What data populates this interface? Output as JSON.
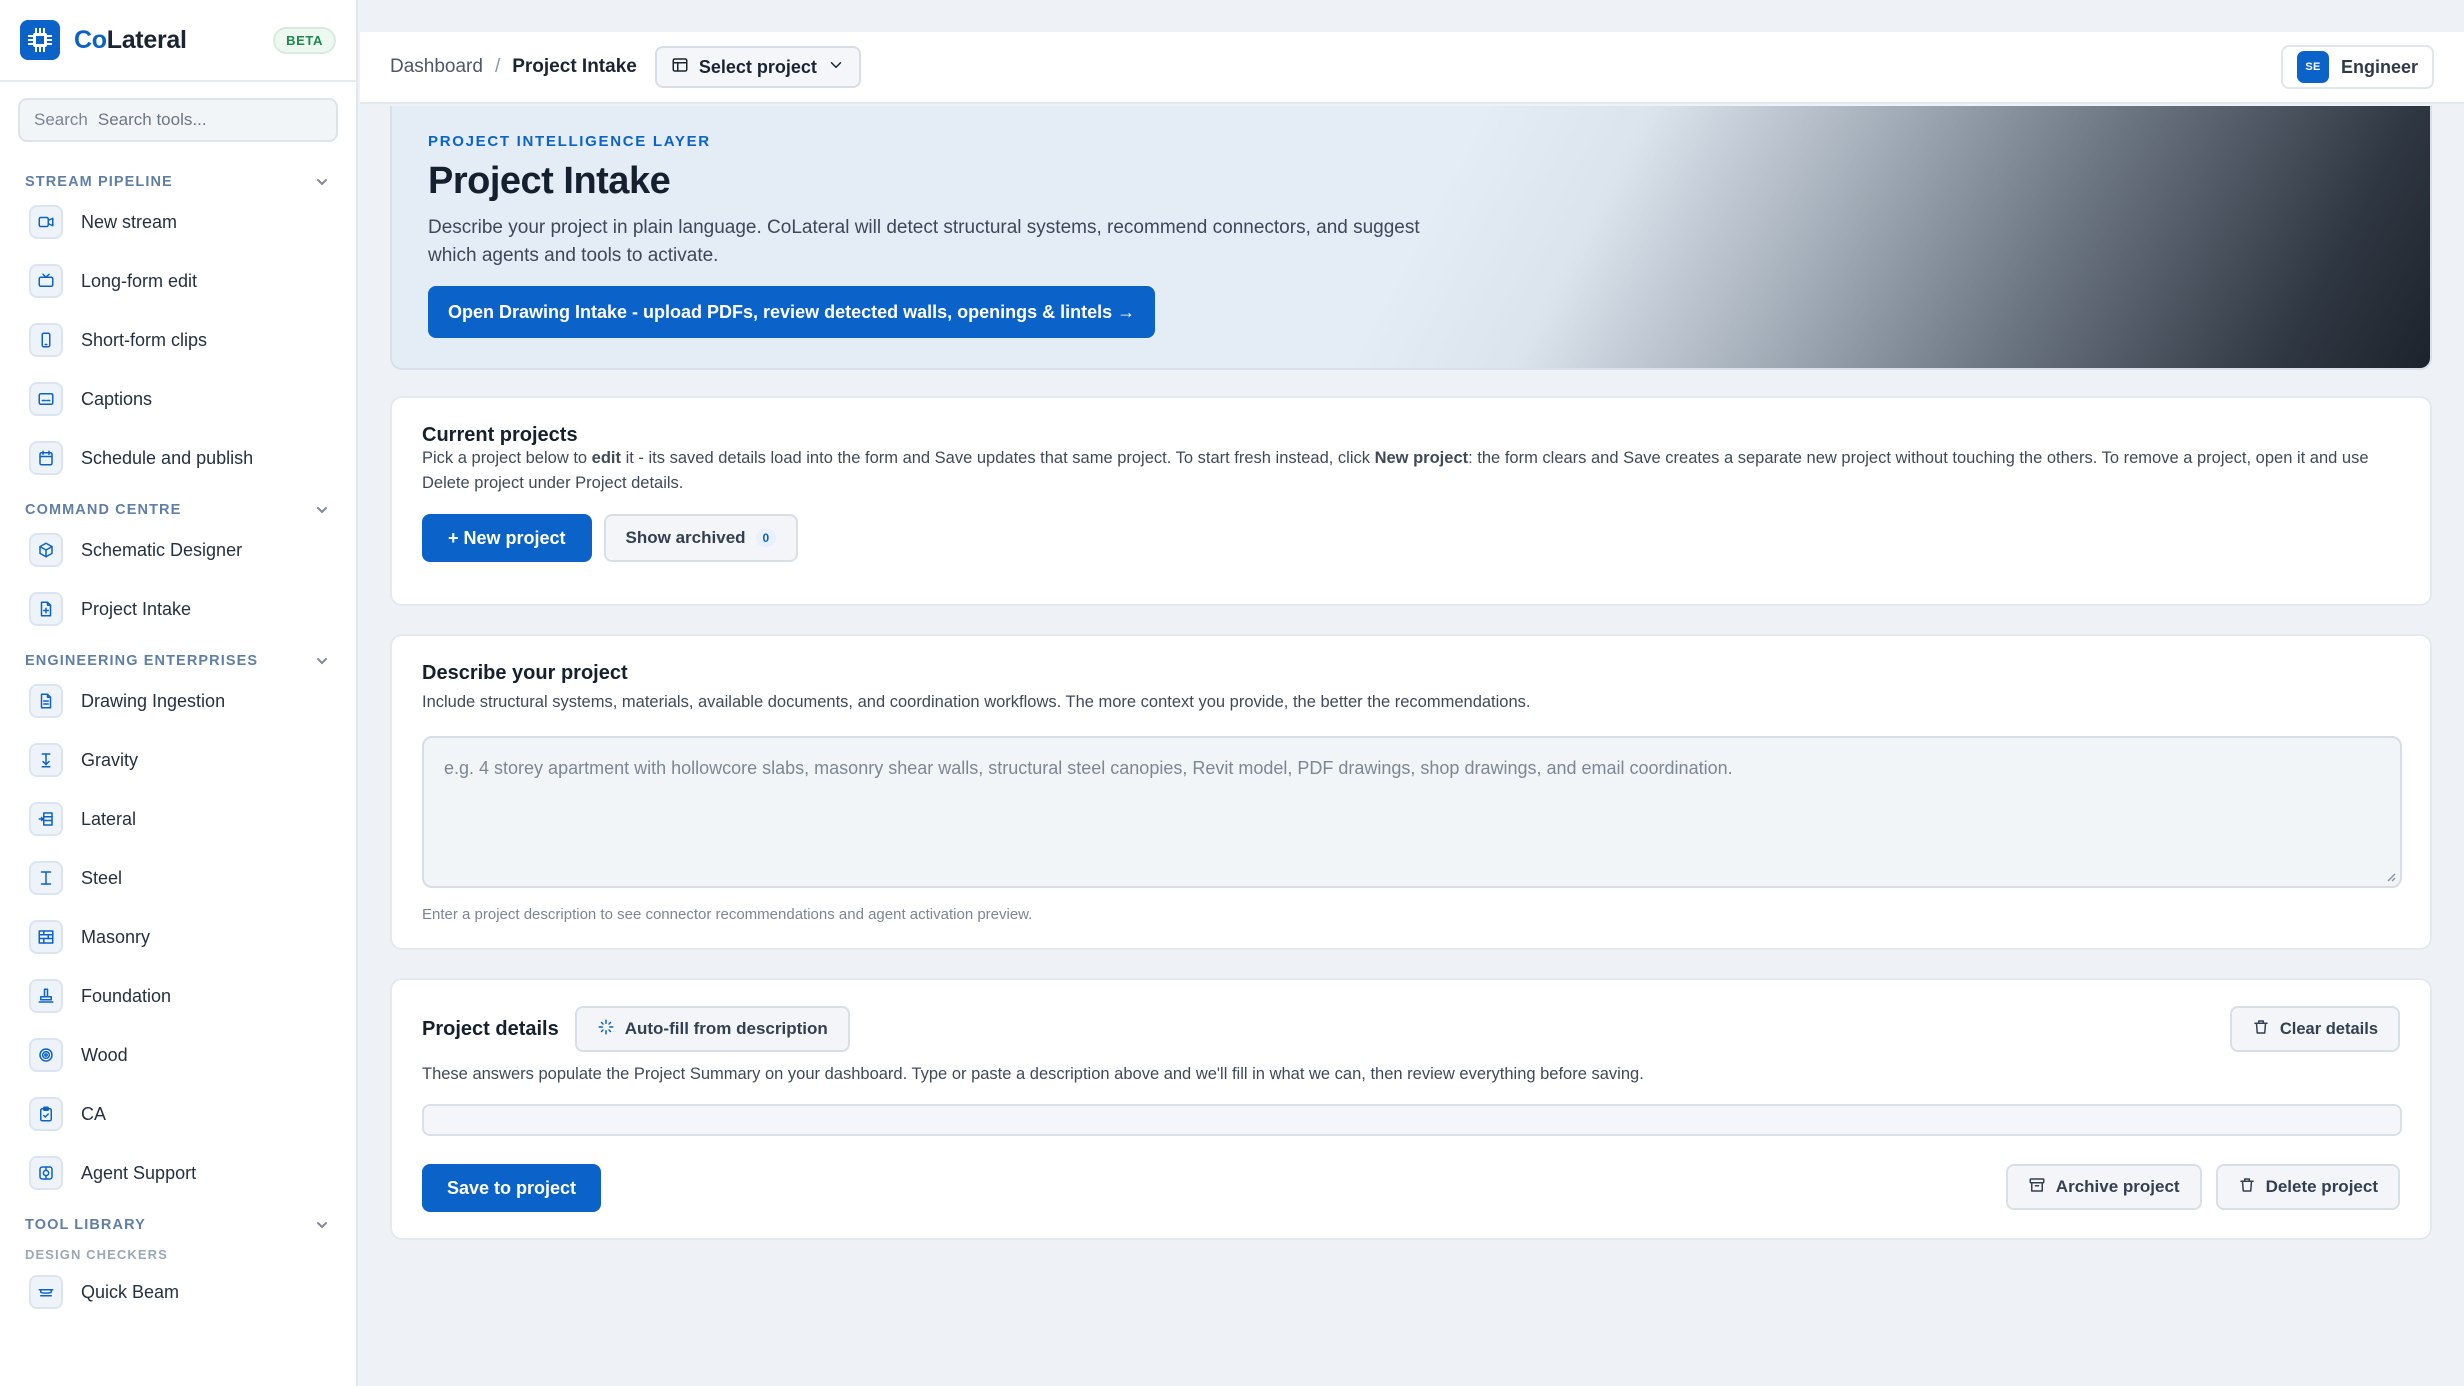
{
  "colors": {
    "accent": "#0b63c9",
    "beta": "#1a8a4a",
    "section": "#5f7fa6"
  },
  "brand": {
    "name_prefix": "Co",
    "name_suffix": "Lateral",
    "badge": "BETA"
  },
  "search": {
    "label": "Search",
    "placeholder": "Search tools..."
  },
  "sidebar": {
    "stream": {
      "title": "STREAM PIPELINE",
      "items": [
        {
          "label": "New stream",
          "icon": "stream-icon"
        },
        {
          "label": "Long-form edit",
          "icon": "tv-icon"
        },
        {
          "label": "Short-form clips",
          "icon": "phone-icon"
        },
        {
          "label": "Captions",
          "icon": "captions-icon"
        },
        {
          "label": "Schedule and publish",
          "icon": "calendar-icon"
        }
      ]
    },
    "command": {
      "title": "COMMAND CENTRE",
      "items": [
        {
          "label": "Schematic Designer",
          "icon": "cube-icon"
        },
        {
          "label": "Project Intake",
          "icon": "file-plus-icon"
        }
      ]
    },
    "engineering": {
      "title": "ENGINEERING ENTERPRISES",
      "items": [
        {
          "label": "Drawing Ingestion",
          "icon": "document-icon"
        },
        {
          "label": "Gravity",
          "icon": "gravity-icon"
        },
        {
          "label": "Lateral",
          "icon": "lateral-icon"
        },
        {
          "label": "Steel",
          "icon": "i-beam-icon"
        },
        {
          "label": "Masonry",
          "icon": "masonry-icon"
        },
        {
          "label": "Foundation",
          "icon": "foundation-icon"
        },
        {
          "label": "Wood",
          "icon": "wood-icon"
        },
        {
          "label": "CA",
          "icon": "clipboard-icon"
        },
        {
          "label": "Agent Support",
          "icon": "support-icon"
        }
      ]
    },
    "tools": {
      "title": "TOOL LIBRARY",
      "subtitle": "DESIGN CHECKERS",
      "items": [
        {
          "label": "Quick Beam",
          "icon": "beam-icon"
        }
      ]
    }
  },
  "topbar": {
    "breadcrumb_root": "Dashboard",
    "breadcrumb_sep": "/",
    "breadcrumb_current": "Project Intake",
    "select_project": "Select project",
    "user_initials": "SE",
    "user_role": "Engineer"
  },
  "hero": {
    "kicker": "PROJECT INTELLIGENCE LAYER",
    "title": "Project Intake",
    "description": "Describe your project in plain language. CoLateral will detect structural systems, recommend connectors, and suggest which agents and tools to activate.",
    "cta": "Open Drawing Intake - upload PDFs, review detected walls, openings & lintels →"
  },
  "current_projects": {
    "title": "Current projects",
    "text_1": "Pick a project below to ",
    "text_bold_1": "edit",
    "text_2": " it - its saved details load into the form and Save updates that same project. To start fresh instead, click ",
    "text_bold_2": "New project",
    "text_3": ": the form clears and Save creates a separate new project without touching the others. To remove a project, open it and use Delete project under Project details.",
    "new_button": "+ New project",
    "archived_button": "Show archived",
    "archived_count": "0"
  },
  "describe": {
    "title": "Describe your project",
    "subtitle": "Include structural systems, materials, available documents, and coordination workflows. The more context you provide, the better the recommendations.",
    "placeholder": "e.g. 4 storey apartment with hollowcore slabs, masonry shear walls, structural steel canopies, Revit model, PDF drawings, shop drawings, and email coordination.",
    "value": "",
    "hint": "Enter a project description to see connector recommendations and agent activation preview."
  },
  "details": {
    "title": "Project details",
    "autofill": "Auto-fill from description",
    "clear": "Clear details",
    "subtitle": "These answers populate the Project Summary on your dashboard. Type or paste a description above and we'll fill in what we can, then review everything before saving.",
    "save": "Save to project",
    "archive": "Archive project",
    "delete": "Delete project"
  }
}
